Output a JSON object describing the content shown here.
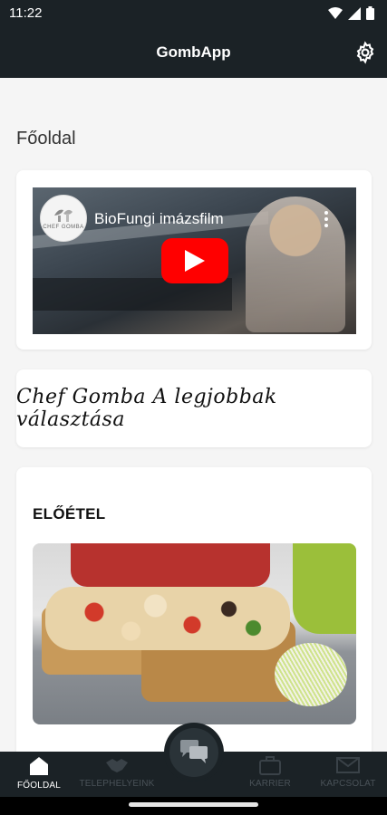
{
  "status_bar": {
    "time": "11:22"
  },
  "app_bar": {
    "title": "GombApp"
  },
  "main": {
    "heading": "Főoldal",
    "video": {
      "title": "BioFungi imázsfilm",
      "channel_logo_text": "CHEF GOMBA"
    },
    "slogan": "Chef Gomba A legjobbak választása",
    "section": {
      "title": "ELŐÉTEL"
    }
  },
  "bottom_nav": {
    "items": [
      {
        "label": "FŐOLDAL",
        "icon": "home-icon",
        "active": true
      },
      {
        "label": "TELEPHELYEINK",
        "icon": "handshake-icon",
        "active": false
      },
      {
        "label": "KARRIER",
        "icon": "briefcase-icon",
        "active": false
      },
      {
        "label": "KAPCSOLAT",
        "icon": "mail-icon",
        "active": false
      }
    ],
    "center_icon": "chat-icon"
  },
  "colors": {
    "bar_background": "#1b2226",
    "content_background": "#f5f5f5",
    "play_red": "#ff0000"
  }
}
